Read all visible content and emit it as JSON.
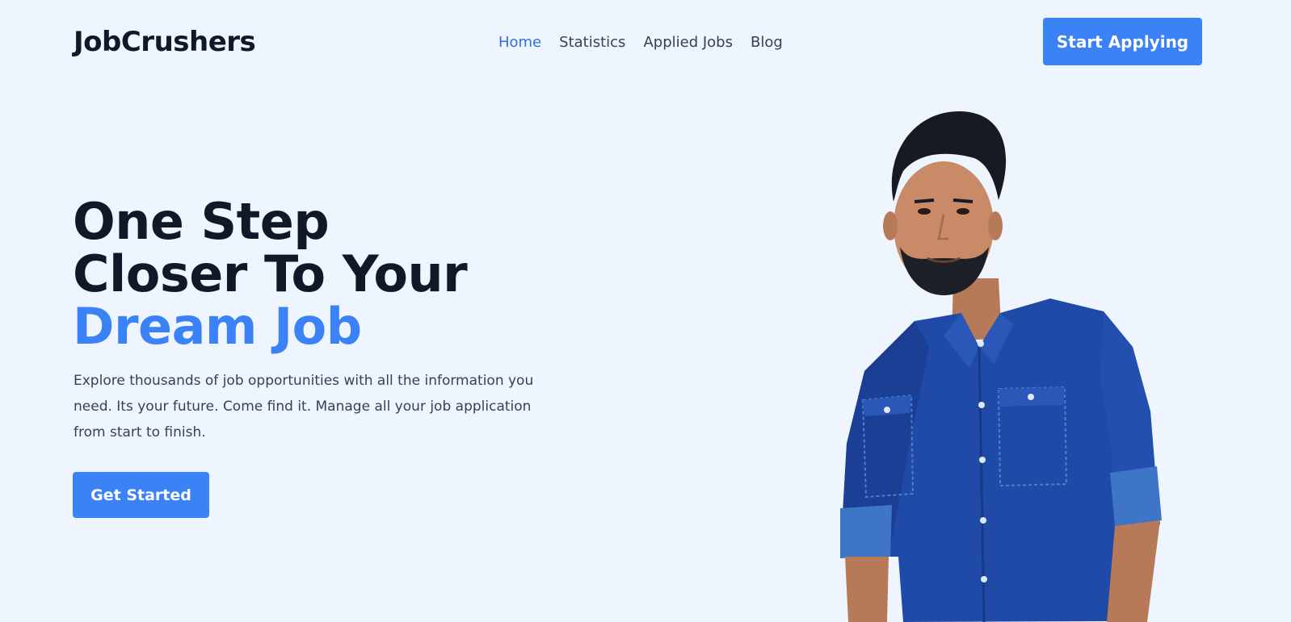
{
  "brand": {
    "name": "JobCrushers"
  },
  "nav": {
    "links": [
      {
        "label": "Home",
        "active": true
      },
      {
        "label": "Statistics",
        "active": false
      },
      {
        "label": "Applied Jobs",
        "active": false
      },
      {
        "label": "Blog",
        "active": false
      }
    ],
    "cta_label": "Start Applying"
  },
  "hero": {
    "title_line1": "One Step",
    "title_line2": "Closer To Your",
    "title_accent": "Dream Job",
    "description": "Explore thousands of job opportunities with all the information you need. Its your future. Come find it. Manage all your job application from start to finish.",
    "button_label": "Get Started",
    "photo_icon": "person-photo"
  },
  "colors": {
    "background": "#eff5ff",
    "accent": "#3b82f6",
    "active_link": "#2f6fe8",
    "heading": "#111827",
    "body_text": "#374151",
    "shirt": "#1f4aa8",
    "skin": "#c98a67",
    "hair": "#151a24"
  }
}
